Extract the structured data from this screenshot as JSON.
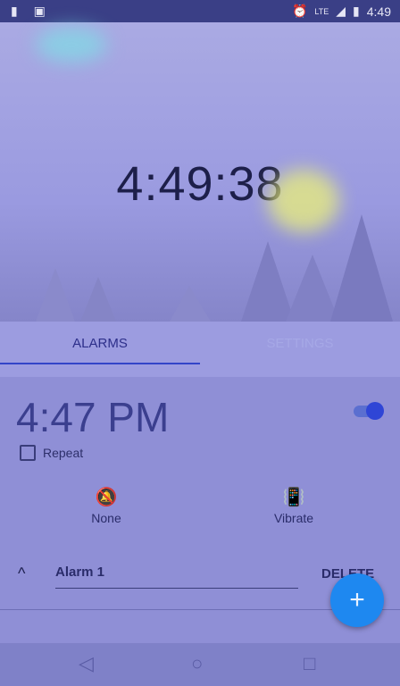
{
  "status": {
    "time": "4:49",
    "left_icons": [
      "sd-card-icon",
      "android-debug-icon"
    ],
    "right_icons": [
      "alarm-icon",
      "lte-icon",
      "signal-icon",
      "battery-icon"
    ],
    "lte_label": "LTE"
  },
  "clock": {
    "time": "4:49:38"
  },
  "tabs": [
    {
      "label": "ALARMS",
      "selected": true
    },
    {
      "label": "SETTINGS",
      "selected": false
    }
  ],
  "alarm": {
    "time": "4:47 PM",
    "enabled": true,
    "repeat_label": "Repeat",
    "repeat_checked": false,
    "sound": {
      "label": "None",
      "icon": "bell-off-icon"
    },
    "vibrate": {
      "label": "Vibrate",
      "icon": "vibrate-icon"
    },
    "collapse_icon": "chevron-up-icon",
    "name": "Alarm 1",
    "delete_label": "DELETE"
  },
  "fab": {
    "icon": "plus-icon",
    "symbol": "+"
  },
  "nav": {
    "back": "◁",
    "home": "○",
    "recent": "□"
  }
}
